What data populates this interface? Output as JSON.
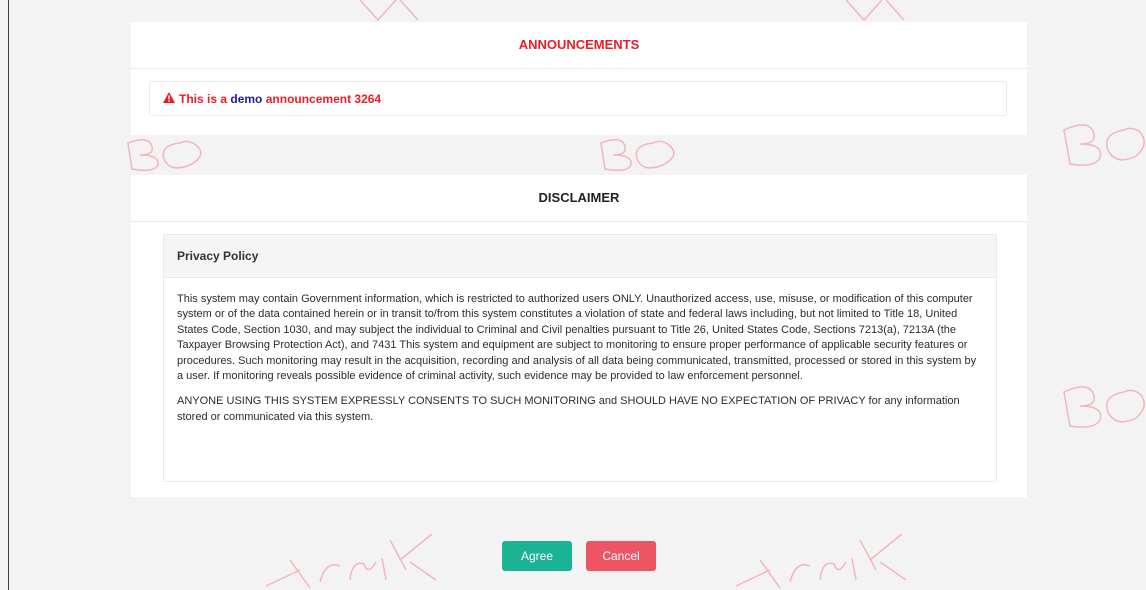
{
  "announcements": {
    "title": "ANNOUNCEMENTS",
    "item": {
      "icon": "warning-icon",
      "prefix": "This is a",
      "highlight": "demo",
      "suffix": "announcement 3264"
    }
  },
  "disclaimer": {
    "title": "DISCLAIMER",
    "panel_title": "Privacy Policy",
    "paragraphs": [
      "This system may contain Government information, which is restricted to authorized users ONLY. Unauthorized access, use, misuse, or modification of this computer system or of the data contained herein or in transit to/from this system constitutes a violation of state and federal laws including, but not limited to Title 18, United States Code, Section 1030, and may subject the individual to Criminal and Civil penalties pursuant to Title 26, United States Code, Sections 7213(a), 7213A (the Taxpayer Browsing Protection Act), and 7431 This system and equipment are subject to monitoring to ensure proper performance of applicable security features or procedures. Such monitoring may result in the acquisition, recording and analysis of all data being communicated, transmitted, processed or stored in this system by a user. If monitoring reveals possible evidence of criminal activity, such evidence may be provided to law enforcement personnel.",
      "ANYONE USING THIS SYSTEM EXPRESSLY CONSENTS TO SUCH MONITORING and SHOULD HAVE NO EXPECTATION OF PRIVACY for any information stored or communicated via this system."
    ]
  },
  "actions": {
    "agree_label": "Agree",
    "cancel_label": "Cancel"
  },
  "colors": {
    "accent_red": "#ed1c24",
    "highlight_blue": "#1c1ca8",
    "agree_green": "#1ab394",
    "cancel_red": "#ed5565",
    "watermark_pink": "#f2b6bc"
  }
}
